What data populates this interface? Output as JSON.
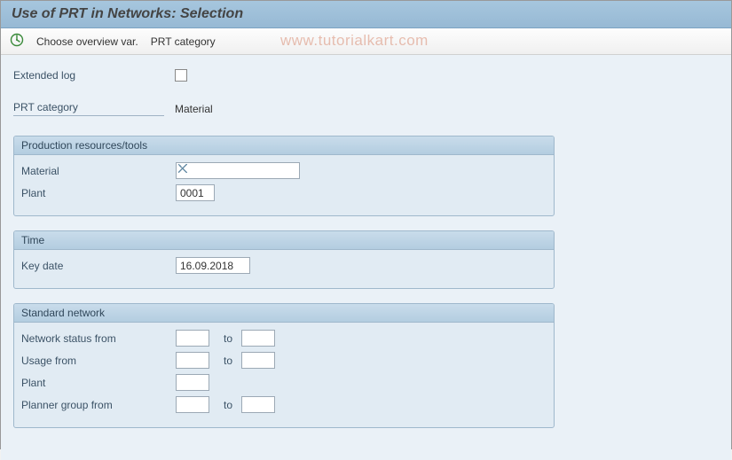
{
  "title": "Use of PRT in Networks: Selection",
  "toolbar": {
    "choose_overview": "Choose overview var.",
    "prt_category": "PRT category"
  },
  "watermark": "www.tutorialkart.com",
  "top_fields": {
    "extended_log_label": "Extended log",
    "extended_log_checked": false,
    "prt_category_label": "PRT category",
    "prt_category_value": "Material"
  },
  "groups": {
    "prt": {
      "header": "Production resources/tools",
      "material_label": "Material",
      "material_value": "",
      "plant_label": "Plant",
      "plant_value": "0001"
    },
    "time": {
      "header": "Time",
      "key_date_label": "Key date",
      "key_date_value": "16.09.2018"
    },
    "std_network": {
      "header": "Standard network",
      "net_status_label": "Network status from",
      "net_status_from": "",
      "net_status_to": "",
      "usage_label": "Usage from",
      "usage_from": "",
      "usage_to": "",
      "plant_label": "Plant",
      "plant_value": "",
      "planner_label": "Planner group from",
      "planner_from": "",
      "planner_to": "",
      "to_label": "to"
    }
  }
}
